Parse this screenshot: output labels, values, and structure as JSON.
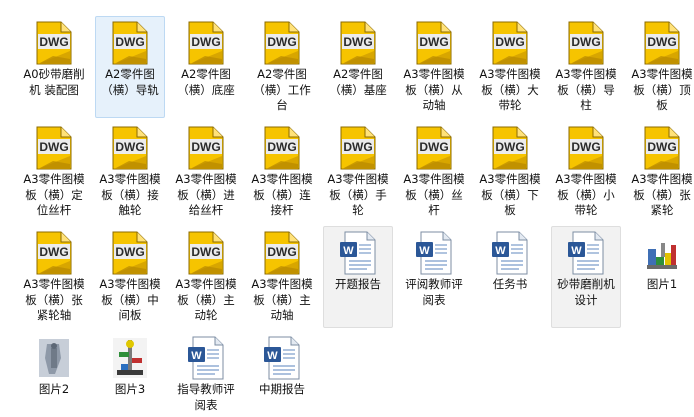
{
  "colors": {
    "selection": "#e6f1fb",
    "hover": "#f2f2f2",
    "dwg_page": "#f2c200",
    "dwg_band": "#eeeeee"
  },
  "files": [
    {
      "label": "A0砂带磨削机 装配图",
      "type": "dwg",
      "icon": "dwg-icon",
      "badge": "DWG"
    },
    {
      "label": "A2零件图（横）导轨",
      "type": "dwg",
      "icon": "dwg-icon",
      "badge": "DWG"
    },
    {
      "label": "A2零件图（横）底座",
      "type": "dwg",
      "icon": "dwg-icon",
      "badge": "DWG"
    },
    {
      "label": "A2零件图（横）工作台",
      "type": "dwg",
      "icon": "dwg-icon",
      "badge": "DWG"
    },
    {
      "label": "A2零件图（横）基座",
      "type": "dwg",
      "icon": "dwg-icon",
      "badge": "DWG"
    },
    {
      "label": "A3零件图模板（横）从动轴",
      "type": "dwg",
      "icon": "dwg-icon",
      "badge": "DWG"
    },
    {
      "label": "A3零件图模板（横）大带轮",
      "type": "dwg",
      "icon": "dwg-icon",
      "badge": "DWG"
    },
    {
      "label": "A3零件图模板（横）导柱",
      "type": "dwg",
      "icon": "dwg-icon",
      "badge": "DWG"
    },
    {
      "label": "A3零件图模板（横）顶板",
      "type": "dwg",
      "icon": "dwg-icon",
      "badge": "DWG"
    },
    {
      "label": "A3零件图模板（横）定位丝杆",
      "type": "dwg",
      "icon": "dwg-icon",
      "badge": "DWG"
    },
    {
      "label": "A3零件图模板（横）接触轮",
      "type": "dwg",
      "icon": "dwg-icon",
      "badge": "DWG"
    },
    {
      "label": "A3零件图模板（横）进给丝杆",
      "type": "dwg",
      "icon": "dwg-icon",
      "badge": "DWG"
    },
    {
      "label": "A3零件图模板（横）连接杆",
      "type": "dwg",
      "icon": "dwg-icon",
      "badge": "DWG"
    },
    {
      "label": "A3零件图模板（横）手轮",
      "type": "dwg",
      "icon": "dwg-icon",
      "badge": "DWG"
    },
    {
      "label": "A3零件图模板（横）丝杆",
      "type": "dwg",
      "icon": "dwg-icon",
      "badge": "DWG"
    },
    {
      "label": "A3零件图模板（横）下板",
      "type": "dwg",
      "icon": "dwg-icon",
      "badge": "DWG"
    },
    {
      "label": "A3零件图模板（横）小带轮",
      "type": "dwg",
      "icon": "dwg-icon",
      "badge": "DWG"
    },
    {
      "label": "A3零件图模板（横）张紧轮",
      "type": "dwg",
      "icon": "dwg-icon",
      "badge": "DWG"
    },
    {
      "label": "A3零件图模板（横）张紧轮轴",
      "type": "dwg",
      "icon": "dwg-icon",
      "badge": "DWG"
    },
    {
      "label": "A3零件图模板（横）中间板",
      "type": "dwg",
      "icon": "dwg-icon",
      "badge": "DWG"
    },
    {
      "label": "A3零件图模板（横）主动轮",
      "type": "dwg",
      "icon": "dwg-icon",
      "badge": "DWG"
    },
    {
      "label": "A3零件图模板（横）主动轴",
      "type": "dwg",
      "icon": "dwg-icon",
      "badge": "DWG"
    },
    {
      "label": "开题报告",
      "type": "doc",
      "icon": "word-document-icon",
      "state": "hover"
    },
    {
      "label": "评阅教师评阅表",
      "type": "doc",
      "icon": "word-document-icon"
    },
    {
      "label": "任务书",
      "type": "doc",
      "icon": "word-document-icon"
    },
    {
      "label": "砂带磨削机设计",
      "type": "doc",
      "icon": "word-document-icon",
      "state": "hover"
    },
    {
      "label": "图片1",
      "type": "img",
      "icon": "image-thumbnail-icon",
      "variant": 1
    },
    {
      "label": "图片2",
      "type": "img",
      "icon": "image-thumbnail-icon",
      "variant": 2
    },
    {
      "label": "图片3",
      "type": "img",
      "icon": "image-thumbnail-icon",
      "variant": 3
    },
    {
      "label": "指导教师评阅表",
      "type": "doc",
      "icon": "word-document-icon"
    },
    {
      "label": "中期报告",
      "type": "doc",
      "icon": "word-document-icon"
    }
  ]
}
